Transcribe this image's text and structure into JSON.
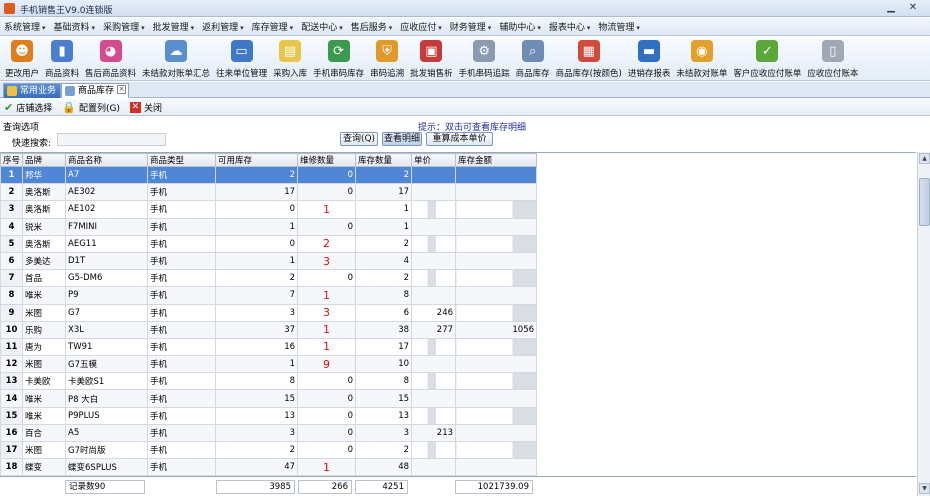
{
  "window": {
    "title": "手机销售王V9.0连锁版",
    "minimize": "▁",
    "close": "✕"
  },
  "menu": [
    "系统管理",
    "基础资料",
    "采购管理",
    "批发管理",
    "返利管理",
    "库存管理",
    "配送中心",
    "售后服务",
    "应收应付",
    "财务管理",
    "辅助中心",
    "报表中心",
    "物流管理"
  ],
  "toolbar": [
    {
      "label": "更改用户",
      "icon": "change-user-icon",
      "color": "#e07f1a"
    },
    {
      "label": "商品资料",
      "icon": "bar-chart-icon",
      "color": "#4a7fd0"
    },
    {
      "label": "售后商品资料",
      "icon": "pie-chart-icon",
      "color": "#d44c8e"
    },
    {
      "label": "未结款对账单汇总",
      "icon": "cloud-icon",
      "color": "#5a8fcf"
    },
    {
      "label": "往来单位管理",
      "icon": "monitor-icon",
      "color": "#3f78c6"
    },
    {
      "label": "采购入库",
      "icon": "note-icon",
      "color": "#e8c64a"
    },
    {
      "label": "手机串码库存",
      "icon": "refresh-icon",
      "color": "#3a9a4d"
    },
    {
      "label": "串码追溯",
      "icon": "shield-icon",
      "color": "#e09a2a"
    },
    {
      "label": "批发销售析",
      "icon": "box-icon",
      "color": "#c43b3b"
    },
    {
      "label": "手机串码追踪",
      "icon": "gear-icon",
      "color": "#8a9bb3"
    },
    {
      "label": "商品库存",
      "icon": "magnifier-icon",
      "color": "#6e8cb5"
    },
    {
      "label": "商品库存(按颜色)",
      "icon": "blocks-icon",
      "color": "#d24a3a"
    },
    {
      "label": "进销存报表",
      "icon": "screen-icon",
      "color": "#2f6fc4"
    },
    {
      "label": "未结款对账单",
      "icon": "coin-icon",
      "color": "#e3a12a"
    },
    {
      "label": "客户应收应付账单",
      "icon": "check-icon",
      "color": "#5aa83a"
    },
    {
      "label": "应收应付账本",
      "icon": "document-icon",
      "color": "#a0a8b5"
    }
  ],
  "tabs": {
    "common": "常用业务",
    "stock": "商品库存",
    "close": "×"
  },
  "subbar": {
    "store": "店铺选择",
    "columns": "配置列(G)",
    "close": "关闭"
  },
  "query": {
    "title": "查询选项",
    "quick_label": "快速搜索:",
    "quick_value": "",
    "hint": "提示：双击可查看库存明细",
    "btn_query": "查询(Q)",
    "btn_detail": "查看明细",
    "btn_recalc": "重算成本单价"
  },
  "table": {
    "columns": [
      "序号",
      "品牌",
      "商品名称",
      "商品类型",
      "可用库存",
      "维修数量",
      "库存数量",
      "单价",
      "库存金额"
    ],
    "rows": [
      [
        "1",
        "邦华",
        "A7",
        "手机",
        "2",
        "0",
        "2",
        "",
        ""
      ],
      [
        "2",
        "奥洛斯",
        "AE302",
        "手机",
        "17",
        "0",
        "17",
        "",
        ""
      ],
      [
        "3",
        "奥洛斯",
        "AE102",
        "手机",
        "0",
        "1",
        "1",
        "",
        ""
      ],
      [
        "4",
        "锐米",
        "F7MINI",
        "手机",
        "1",
        "0",
        "1",
        "",
        ""
      ],
      [
        "5",
        "奥洛斯",
        "AEG11",
        "手机",
        "0",
        "2",
        "2",
        "",
        ""
      ],
      [
        "6",
        "多美达",
        "D1T",
        "手机",
        "1",
        "3",
        "4",
        "",
        ""
      ],
      [
        "7",
        "首品",
        "G5-DM6",
        "手机",
        "2",
        "0",
        "2",
        "",
        ""
      ],
      [
        "8",
        "唯米",
        "P9",
        "手机",
        "7",
        "1",
        "8",
        "",
        ""
      ],
      [
        "9",
        "米图",
        "G7",
        "手机",
        "3",
        "3",
        "6",
        "246",
        ""
      ],
      [
        "10",
        "乐购",
        "X3L",
        "手机",
        "37",
        "1",
        "38",
        "277",
        "1056"
      ],
      [
        "11",
        "唐为",
        "TW91",
        "手机",
        "16",
        "1",
        "17",
        "",
        ""
      ],
      [
        "12",
        "米图",
        "G7五模",
        "手机",
        "1",
        "9",
        "10",
        "",
        ""
      ],
      [
        "13",
        "卡美欧",
        "卡美欧S1",
        "手机",
        "8",
        "0",
        "8",
        "",
        ""
      ],
      [
        "14",
        "唯米",
        "P8 大白",
        "手机",
        "15",
        "0",
        "15",
        "",
        ""
      ],
      [
        "15",
        "唯米",
        "P9PLUS",
        "手机",
        "13",
        "0",
        "13",
        "",
        ""
      ],
      [
        "16",
        "百合",
        "A5",
        "手机",
        "3",
        "0",
        "3",
        "213",
        ""
      ],
      [
        "17",
        "米图",
        "G7时尚版",
        "手机",
        "2",
        "0",
        "2",
        "",
        ""
      ],
      [
        "18",
        "蝶变",
        "蝶变6SPLUS",
        "手机",
        "47",
        "1",
        "48",
        "",
        ""
      ]
    ]
  },
  "footer": {
    "records": "记录数90",
    "avail": "3985",
    "repair": "266",
    "stock": "4251",
    "amount": "1021739.09"
  }
}
